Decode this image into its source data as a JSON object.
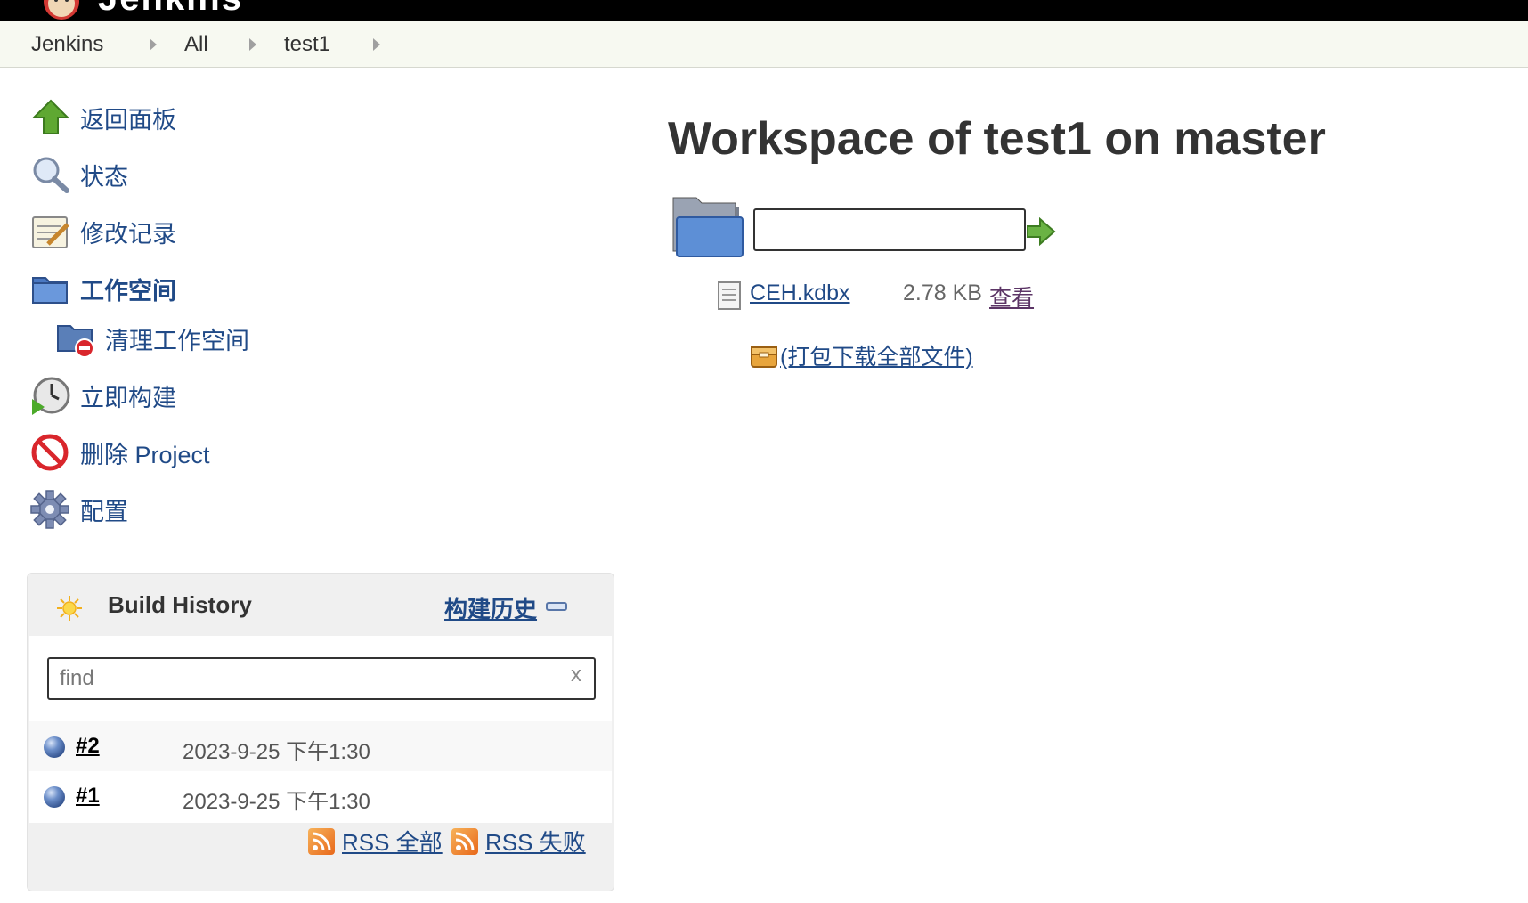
{
  "header": {
    "logo_text": "Jenkins"
  },
  "breadcrumb": {
    "items": [
      "Jenkins",
      "All",
      "test1"
    ]
  },
  "sidebar": {
    "tasks": [
      {
        "label": "返回面板",
        "icon": "up-arrow-icon"
      },
      {
        "label": "状态",
        "icon": "magnifier-icon"
      },
      {
        "label": "修改记录",
        "icon": "notepad-icon"
      },
      {
        "label": "工作空间",
        "icon": "folder-icon"
      },
      {
        "label": "清理工作空间",
        "icon": "folder-delete-icon"
      },
      {
        "label": "立即构建",
        "icon": "clock-play-icon"
      },
      {
        "label": "删除 Project",
        "icon": "no-entry-icon"
      },
      {
        "label": "配置",
        "icon": "gear-icon"
      }
    ]
  },
  "build_history": {
    "title": "Build History",
    "trend_link": "构建历史",
    "search_placeholder": "find",
    "clear_label": "x",
    "builds": [
      {
        "number": "#2",
        "time": "2023-9-25 下午1:30"
      },
      {
        "number": "#1",
        "time": "2023-9-25 下午1:30"
      }
    ],
    "rss_all": "RSS 全部",
    "rss_failed": "RSS 失败"
  },
  "main": {
    "title": "Workspace of test1 on master",
    "path_value": "",
    "files": [
      {
        "name": "CEH.kdbx",
        "size": "2.78 KB",
        "view_label": "查看"
      }
    ],
    "zip_label": "(打包下载全部文件)"
  },
  "colors": {
    "link": "#204a87",
    "visited": "#5c3566",
    "header_bg": "#000000",
    "breadcrumb_bg": "#f7f9f1"
  }
}
